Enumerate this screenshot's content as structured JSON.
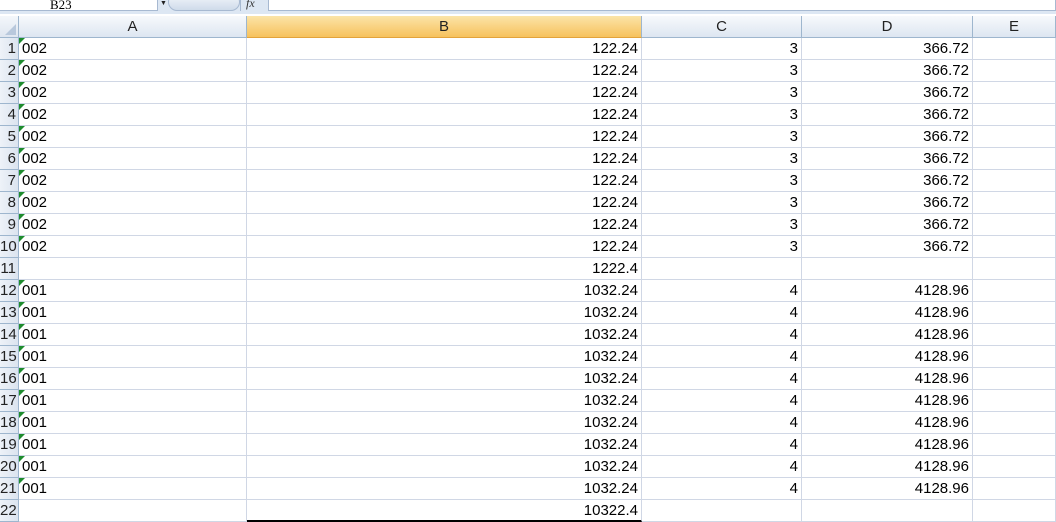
{
  "name_box": {
    "value": "B23"
  },
  "formula_bar": {
    "fx_label": "fx",
    "value": ""
  },
  "columns": [
    "A",
    "B",
    "C",
    "D",
    "E"
  ],
  "selected_column": "B",
  "rows": [
    {
      "num": "1",
      "a": "002",
      "b": "122.24",
      "c": "3",
      "d": "366.72",
      "e": ""
    },
    {
      "num": "2",
      "a": "002",
      "b": "122.24",
      "c": "3",
      "d": "366.72",
      "e": ""
    },
    {
      "num": "3",
      "a": "002",
      "b": "122.24",
      "c": "3",
      "d": "366.72",
      "e": ""
    },
    {
      "num": "4",
      "a": "002",
      "b": "122.24",
      "c": "3",
      "d": "366.72",
      "e": ""
    },
    {
      "num": "5",
      "a": "002",
      "b": "122.24",
      "c": "3",
      "d": "366.72",
      "e": ""
    },
    {
      "num": "6",
      "a": "002",
      "b": "122.24",
      "c": "3",
      "d": "366.72",
      "e": ""
    },
    {
      "num": "7",
      "a": "002",
      "b": "122.24",
      "c": "3",
      "d": "366.72",
      "e": ""
    },
    {
      "num": "8",
      "a": "002",
      "b": "122.24",
      "c": "3",
      "d": "366.72",
      "e": ""
    },
    {
      "num": "9",
      "a": "002",
      "b": "122.24",
      "c": "3",
      "d": "366.72",
      "e": ""
    },
    {
      "num": "10",
      "a": "002",
      "b": "122.24",
      "c": "3",
      "d": "366.72",
      "e": ""
    },
    {
      "num": "11",
      "a": "",
      "b": "1222.4",
      "c": "",
      "d": "",
      "e": ""
    },
    {
      "num": "12",
      "a": "001",
      "b": "1032.24",
      "c": "4",
      "d": "4128.96",
      "e": ""
    },
    {
      "num": "13",
      "a": "001",
      "b": "1032.24",
      "c": "4",
      "d": "4128.96",
      "e": ""
    },
    {
      "num": "14",
      "a": "001",
      "b": "1032.24",
      "c": "4",
      "d": "4128.96",
      "e": ""
    },
    {
      "num": "15",
      "a": "001",
      "b": "1032.24",
      "c": "4",
      "d": "4128.96",
      "e": ""
    },
    {
      "num": "16",
      "a": "001",
      "b": "1032.24",
      "c": "4",
      "d": "4128.96",
      "e": ""
    },
    {
      "num": "17",
      "a": "001",
      "b": "1032.24",
      "c": "4",
      "d": "4128.96",
      "e": ""
    },
    {
      "num": "18",
      "a": "001",
      "b": "1032.24",
      "c": "4",
      "d": "4128.96",
      "e": ""
    },
    {
      "num": "19",
      "a": "001",
      "b": "1032.24",
      "c": "4",
      "d": "4128.96",
      "e": ""
    },
    {
      "num": "20",
      "a": "001",
      "b": "1032.24",
      "c": "4",
      "d": "4128.96",
      "e": ""
    },
    {
      "num": "21",
      "a": "001",
      "b": "1032.24",
      "c": "4",
      "d": "4128.96",
      "e": ""
    },
    {
      "num": "22",
      "a": "",
      "b": "10322.4",
      "c": "",
      "d": "",
      "e": ""
    }
  ],
  "colors": {
    "text_indicator": "#1e8c2e",
    "selected_header": "#f7c25d",
    "gridline": "#d0d7e5"
  }
}
